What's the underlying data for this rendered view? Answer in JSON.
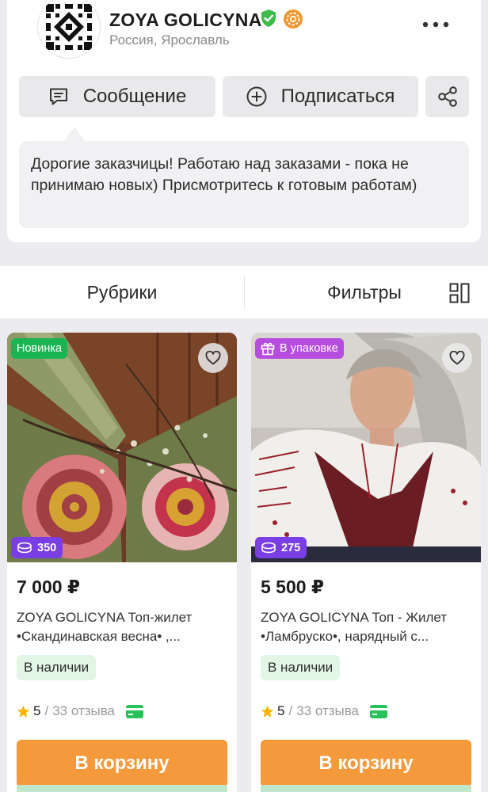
{
  "shop": {
    "name": "ZOYA GOLICYNA",
    "location": "Россия, Ярославль",
    "verified_icon": "shield-check-icon",
    "master_icon": "gear-badge-icon",
    "more_icon": "more-dots-icon",
    "colors": {
      "verified": "#3dbb4b",
      "master": "#f0962f"
    }
  },
  "actions": {
    "message_label": "Сообщение",
    "subscribe_label": "Подписаться",
    "share_icon": "share-icon"
  },
  "announcement": "Дорогие заказчицы! Работаю над заказами - пока не принимаю новых) Присмотритесь к готовым работам)",
  "filter_bar": {
    "rubrics_label": "Рубрики",
    "filters_label": "Фильтры",
    "layout_icon": "grid-layout-icon"
  },
  "products": [
    {
      "tag": "Новинка",
      "bonus": "350",
      "price": "7 000 ₽",
      "title": "ZOYA GOLICYNA Топ-жилет •Скандинавская весна• ,...",
      "stock": "В наличии",
      "rating": "5",
      "separator": "/",
      "reviews": "33 отзыва",
      "cart_label": "В корзину"
    },
    {
      "tag": "В упаковке",
      "bonus": "275",
      "price": "5 500 ₽",
      "title": "ZOYA GOLICYNA Топ - Жилет •Ламбруско•, нарядный с...",
      "stock": "В наличии",
      "rating": "5",
      "separator": "/",
      "reviews": "33 отзыва",
      "cart_label": "В корзину"
    }
  ],
  "colors": {
    "new_tag": "#1ab552",
    "gift_tag": "#b64ddf",
    "bonus": "#7a3fe4",
    "cart_button": "#f59a3c",
    "stock_bg": "#e3f6e6"
  }
}
